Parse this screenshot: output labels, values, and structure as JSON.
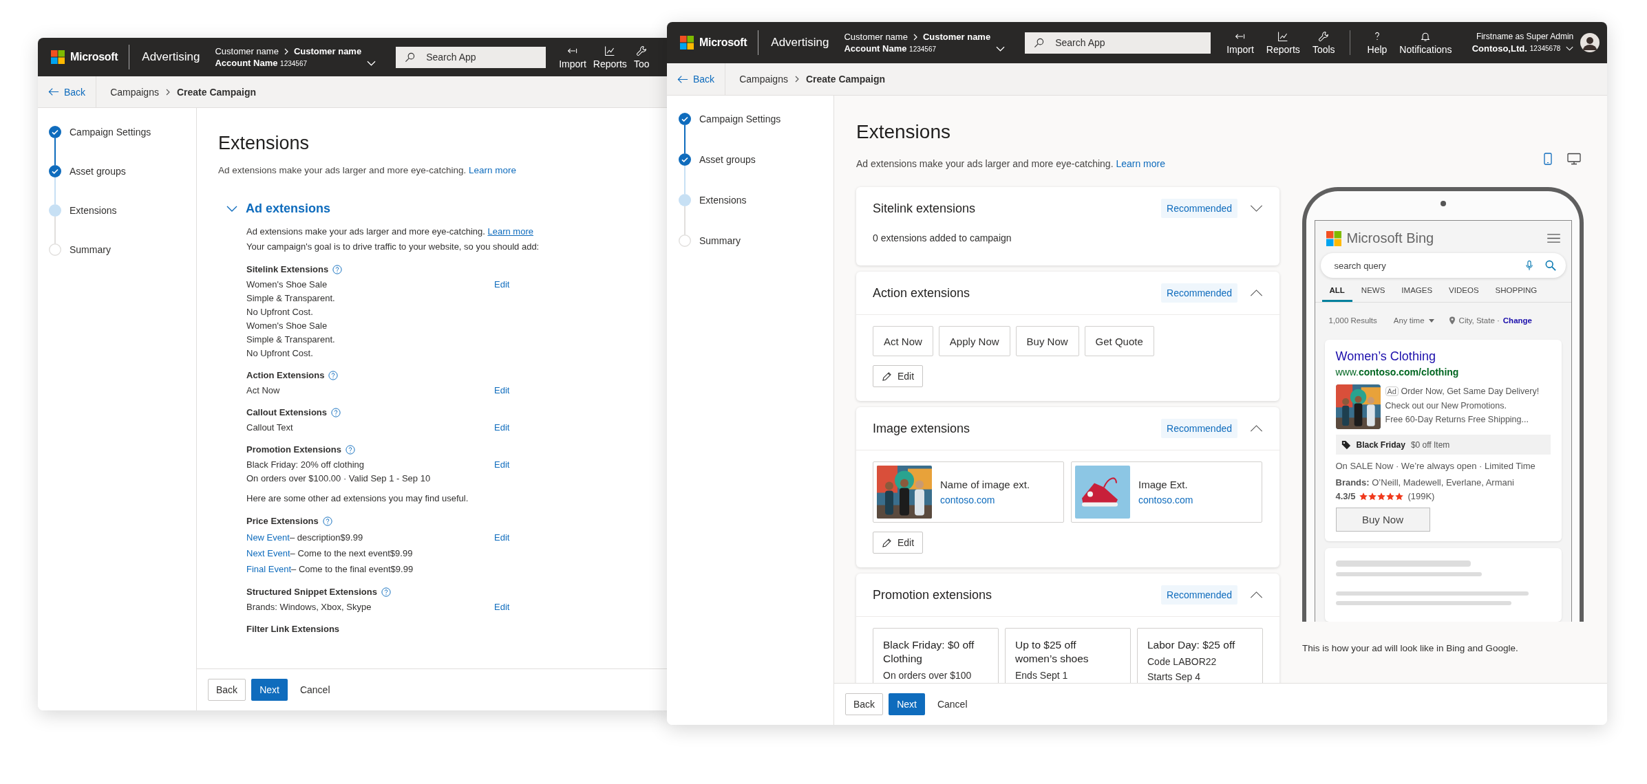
{
  "back_window": {
    "header": {
      "brand": "Microsoft",
      "product": "Advertising",
      "customer_label": "Customer name",
      "customer_name": "Customer name",
      "account_name": "Account Name",
      "account_id": "1234567",
      "search": {
        "placeholder": "Search App"
      },
      "tools": [
        {
          "kind": "import",
          "label": "Import"
        },
        {
          "kind": "reports",
          "label": "Reports"
        },
        {
          "kind": "tools",
          "label": "Too"
        }
      ]
    },
    "nav": {
      "back": "Back",
      "breadcrumb": [
        "Campaigns",
        "Create Campaign"
      ]
    },
    "steps": [
      {
        "label": "Campaign Settings",
        "kind": "done"
      },
      {
        "label": "Asset groups",
        "kind": "done"
      },
      {
        "label": "Extensions",
        "kind": "current"
      },
      {
        "label": "Summary",
        "kind": "todo"
      }
    ],
    "title": "Extensions",
    "description": "Ad extensions make your ads larger and more eye-catching.",
    "learn_more": "Learn more",
    "section": {
      "title": "Ad extensions",
      "expanded": true,
      "intro": "Ad extensions make your ads larger and more eye-catching.",
      "intro_link": "Learn more",
      "goal": "Your campaign's goal is to drive traffic to your website, so you should add:",
      "blocks": [
        {
          "kind": "group",
          "title": "Sitelink Extensions",
          "help": true,
          "edit": "Edit",
          "lines": [
            {
              "text": "Women's Shoe Sale"
            },
            {
              "text": "Simple & Transparent."
            },
            {
              "text": "No Upfront Cost."
            },
            {
              "text": "Women's Shoe Sale"
            },
            {
              "text": "Simple & Transparent."
            },
            {
              "text": "No Upfront Cost."
            }
          ]
        },
        {
          "kind": "group",
          "title": "Action Extensions",
          "help": true,
          "edit": "Edit",
          "lines": [
            {
              "text": "Act Now"
            }
          ]
        },
        {
          "kind": "group",
          "title": "Callout Extensions",
          "help": true,
          "edit": "Edit",
          "lines": [
            {
              "text": "Callout Text"
            }
          ]
        },
        {
          "kind": "group",
          "title": "Promotion Extensions",
          "help": true,
          "edit": "Edit",
          "lines": [
            {
              "text": "Black Friday: 20% off clothing"
            },
            {
              "text": "On orders over $100.00 · Valid Sep 1 - Sep 10"
            }
          ]
        },
        {
          "kind": "note",
          "text": "Here are some other ad extensions you may find useful."
        },
        {
          "kind": "group",
          "title": "Price Extensions",
          "help": true,
          "edit": "Edit",
          "lines": [
            {
              "link": "New Event",
              "text": "– description$9.99"
            },
            {
              "link": "Next Event",
              "text": "– Come to the next event$9.99"
            },
            {
              "link": "Final Event",
              "text": "– Come to the final event$9.99"
            }
          ]
        },
        {
          "kind": "group",
          "title": "Structured Snippet Extensions",
          "help": true,
          "edit": "Edit",
          "lines": [
            {
              "text": "Brands: Windows, Xbox, Skype"
            }
          ]
        },
        {
          "kind": "group",
          "title": "Filter Link Extensions",
          "help": false
        }
      ]
    },
    "footer": {
      "back": "Back",
      "next": "Next",
      "cancel": "Cancel"
    }
  },
  "front_window": {
    "header": {
      "brand": "Microsoft",
      "product": "Advertising",
      "customer_label": "Customer name",
      "customer_name": "Customer name",
      "account_name": "Account Name",
      "account_id": "1234567",
      "search": {
        "placeholder": "Search App"
      },
      "tools": [
        {
          "kind": "import",
          "label": "Import"
        },
        {
          "kind": "reports",
          "label": "Reports"
        },
        {
          "kind": "tools",
          "label": "Tools"
        },
        {
          "kind": "help",
          "label": "Help"
        },
        {
          "kind": "notifications",
          "label": "Notifications"
        }
      ],
      "user": {
        "role": "Firstname as Super Admin",
        "company": "Contoso,Ltd.",
        "company_id": "12345678"
      }
    },
    "nav": {
      "back": "Back",
      "breadcrumb": [
        "Campaigns",
        "Create Campaign"
      ]
    },
    "steps": [
      {
        "label": "Campaign Settings",
        "kind": "done"
      },
      {
        "label": "Asset groups",
        "kind": "done"
      },
      {
        "label": "Extensions",
        "kind": "current"
      },
      {
        "label": "Summary",
        "kind": "todo"
      }
    ],
    "title": "Extensions",
    "description": "Ad extensions make your ads larger and more eye-catching.",
    "learn_more": "Learn more",
    "devices": [
      {
        "kind": "mobile",
        "selected": true
      },
      {
        "kind": "desktop",
        "selected": false
      }
    ],
    "cards": [
      {
        "kind": "summary",
        "title": "Sitelink extensions",
        "badge": "Recommended",
        "expanded": false,
        "summary": "0 extensions added to campaign"
      },
      {
        "kind": "actions",
        "title": "Action extensions",
        "badge": "Recommended",
        "expanded": true,
        "actions": [
          "Act Now",
          "Apply Now",
          "Buy Now",
          "Get Quote"
        ],
        "edit": "Edit"
      },
      {
        "kind": "images",
        "title": "Image extensions",
        "badge": "Recommended",
        "expanded": true,
        "images": [
          {
            "name": "Name of image ext.",
            "url": "contoso.com"
          },
          {
            "name": "Image Ext.",
            "url": "contoso.com"
          }
        ],
        "edit": "Edit"
      },
      {
        "kind": "promotions",
        "title": "Promotion extensions",
        "badge": "Recommended",
        "expanded": true,
        "promotions": [
          {
            "title": "Black Friday: $0 off Clothing",
            "lines": [
              "On orders over $100"
            ]
          },
          {
            "title": "Up to $25 off women’s shoes",
            "lines": [
              "Ends Sept 1"
            ]
          },
          {
            "title": "Labor Day: $25 off",
            "lines": [
              "Code LABOR22",
              "Starts Sep 4"
            ]
          }
        ]
      }
    ],
    "preview": {
      "brand": "Microsoft Bing",
      "search": {
        "value": "search query"
      },
      "tabs": [
        {
          "label": "ALL",
          "selected": true
        },
        {
          "label": "NEWS",
          "selected": false
        },
        {
          "label": "IMAGES",
          "selected": false
        },
        {
          "label": "VIDEOS",
          "selected": false
        },
        {
          "label": "SHOPPING",
          "selected": false
        }
      ],
      "results": "1,000 Results",
      "time_filter": "Any time",
      "location": "City, State ·",
      "change": "Change",
      "ad": {
        "title": "Women’s Clothing",
        "url": "www.**contoso.com/clothing**",
        "label": "Ad",
        "lines": [
          "Order Now, Get Same Day Delivery!",
          "Check out our New Promotions.",
          "Free 60-Day Returns Free Shipping..."
        ],
        "promo_title": "Black Friday",
        "promo_text": "$0 off Item",
        "highlights": "On SALE Now · We’re always open · Limited Time",
        "brands": "**Brands:** O’Neill, Madewell, Everlane, Armani",
        "rating": "4.3/5",
        "stars": 5,
        "reviews": "(199K)",
        "cta": "Buy Now"
      },
      "caption": "This is how your ad will look like in Bing and Google."
    },
    "footer": {
      "back": "Back",
      "next": "Next",
      "cancel": "Cancel"
    }
  }
}
